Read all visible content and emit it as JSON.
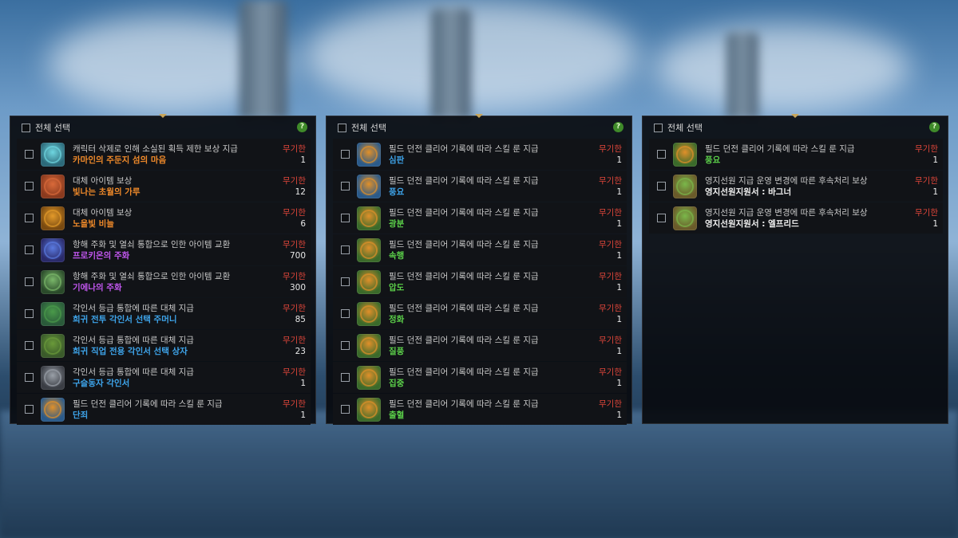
{
  "colors": {
    "orange": "#f08a2a",
    "blue": "#3ea4ea",
    "purple": "#c257f0",
    "green": "#5cd14a",
    "duration": "#e0463a"
  },
  "panels": [
    {
      "header": {
        "select_all": "전체 선택",
        "help": "?"
      },
      "items": [
        {
          "desc": "캐릭터 삭제로 인해 소실된 획득 제한 보상 지급",
          "name": "카마인의 주둔지 섬의 마음",
          "name_color": "orange",
          "duration": "무기한",
          "qty": "1",
          "icon": "island-heart-icon",
          "icon_bg": "#2c6a7a",
          "glyph": "#6fd6e0"
        },
        {
          "desc": "대체 아이템 보상",
          "name": "빛나는 초월의 가루",
          "name_color": "orange",
          "duration": "무기한",
          "qty": "12",
          "icon": "powder-icon",
          "icon_bg": "#8a3a1e",
          "glyph": "#d96a3a"
        },
        {
          "desc": "대체 아이템 보상",
          "name": "노을빛 비늘",
          "name_color": "orange",
          "duration": "무기한",
          "qty": "6",
          "icon": "scale-icon",
          "icon_bg": "#7a4a10",
          "glyph": "#e39a2a"
        },
        {
          "desc": "항해 주화 및 열쇠 통합으로 인한 아이템 교환",
          "name": "프로키온의 주화",
          "name_color": "purple",
          "duration": "무기한",
          "qty": "700",
          "icon": "coin-icon",
          "icon_bg": "#2a2a6a",
          "glyph": "#5a7ae0"
        },
        {
          "desc": "항해 주화 및 열쇠 통합으로 인한 아이템 교환",
          "name": "기에나의 주화",
          "name_color": "purple",
          "duration": "무기한",
          "qty": "300",
          "icon": "coin-icon",
          "icon_bg": "#2a4a2a",
          "glyph": "#7ab86a"
        },
        {
          "desc": "각인서 등급 통합에 따른 대체 지급",
          "name": "희귀 전투 각인서 선택 주머니",
          "name_color": "blue",
          "duration": "무기한",
          "qty": "85",
          "icon": "pouch-icon",
          "icon_bg": "#2a5a3a",
          "glyph": "#4a9a4a"
        },
        {
          "desc": "각인서 등급 통합에 따른 대체 지급",
          "name": "희귀 직업 전용 각인서 선택 상자",
          "name_color": "blue",
          "duration": "무기한",
          "qty": "23",
          "icon": "chest-icon",
          "icon_bg": "#3a5a2a",
          "glyph": "#6a9a3a"
        },
        {
          "desc": "각인서 등급 통합에 따른 대체 지급",
          "name": "구슬동자 각인서",
          "name_color": "blue",
          "duration": "무기한",
          "qty": "1",
          "icon": "book-icon",
          "icon_bg": "#3a3d44",
          "glyph": "#9aa0a8"
        },
        {
          "desc": "필드 던전 클리어 기록에 따라 스킬 룬 지급",
          "name": "단죄",
          "name_color": "blue",
          "duration": "무기한",
          "qty": "1",
          "icon": "rune-icon",
          "icon_bg": "#2a5a8a",
          "glyph": "#e0902a"
        }
      ]
    },
    {
      "header": {
        "select_all": "전체 선택",
        "help": "?"
      },
      "items": [
        {
          "desc": "필드 던전 클리어 기록에 따라 스킬 룬 지급",
          "name": "심판",
          "name_color": "blue",
          "duration": "무기한",
          "qty": "1",
          "icon": "rune-icon",
          "icon_bg": "#2a5a8a",
          "glyph": "#e0902a"
        },
        {
          "desc": "필드 던전 클리어 기록에 따라 스킬 룬 지급",
          "name": "풍요",
          "name_color": "blue",
          "duration": "무기한",
          "qty": "1",
          "icon": "rune-icon",
          "icon_bg": "#2a5a8a",
          "glyph": "#e0902a"
        },
        {
          "desc": "필드 던전 클리어 기록에 따라 스킬 룬 지급",
          "name": "광분",
          "name_color": "green",
          "duration": "무기한",
          "qty": "1",
          "icon": "rune-icon",
          "icon_bg": "#3a6a2a",
          "glyph": "#e0902a"
        },
        {
          "desc": "필드 던전 클리어 기록에 따라 스킬 룬 지급",
          "name": "속행",
          "name_color": "green",
          "duration": "무기한",
          "qty": "1",
          "icon": "rune-icon",
          "icon_bg": "#3a6a2a",
          "glyph": "#e0902a"
        },
        {
          "desc": "필드 던전 클리어 기록에 따라 스킬 룬 지급",
          "name": "압도",
          "name_color": "green",
          "duration": "무기한",
          "qty": "1",
          "icon": "rune-icon",
          "icon_bg": "#3a6a2a",
          "glyph": "#e0902a"
        },
        {
          "desc": "필드 던전 클리어 기록에 따라 스킬 룬 지급",
          "name": "정화",
          "name_color": "green",
          "duration": "무기한",
          "qty": "1",
          "icon": "rune-icon",
          "icon_bg": "#3a6a2a",
          "glyph": "#e0902a"
        },
        {
          "desc": "필드 던전 클리어 기록에 따라 스킬 룬 지급",
          "name": "질풍",
          "name_color": "green",
          "duration": "무기한",
          "qty": "1",
          "icon": "rune-icon",
          "icon_bg": "#3a6a2a",
          "glyph": "#e0902a"
        },
        {
          "desc": "필드 던전 클리어 기록에 따라 스킬 룬 지급",
          "name": "집중",
          "name_color": "green",
          "duration": "무기한",
          "qty": "1",
          "icon": "rune-icon",
          "icon_bg": "#3a6a2a",
          "glyph": "#e0902a"
        },
        {
          "desc": "필드 던전 클리어 기록에 따라 스킬 룬 지급",
          "name": "출혈",
          "name_color": "green",
          "duration": "무기한",
          "qty": "1",
          "icon": "rune-icon",
          "icon_bg": "#3a6a2a",
          "glyph": "#e0902a"
        }
      ]
    },
    {
      "header": {
        "select_all": "전체 선택",
        "help": "?"
      },
      "items": [
        {
          "desc": "필드 던전 클리어 기록에 따라 스킬 룬 지급",
          "name": "풍요",
          "name_color": "green",
          "duration": "무기한",
          "qty": "1",
          "icon": "rune-icon",
          "icon_bg": "#3a6a2a",
          "glyph": "#e0902a"
        },
        {
          "desc": "영지선원 지급 운영 변경에 따른 후속처리 보상",
          "name": "영지선원지원서 : 바그너",
          "name_color": "white",
          "duration": "무기한",
          "qty": "1",
          "icon": "application-icon",
          "icon_bg": "#6a5a2a",
          "glyph": "#7ab84a"
        },
        {
          "desc": "영지선원 지급 운영 변경에 따른 후속처리 보상",
          "name": "영지선원지원서 : 엘프리드",
          "name_color": "white",
          "duration": "무기한",
          "qty": "1",
          "icon": "application-icon",
          "icon_bg": "#6a5a2a",
          "glyph": "#7ab84a"
        }
      ]
    }
  ]
}
